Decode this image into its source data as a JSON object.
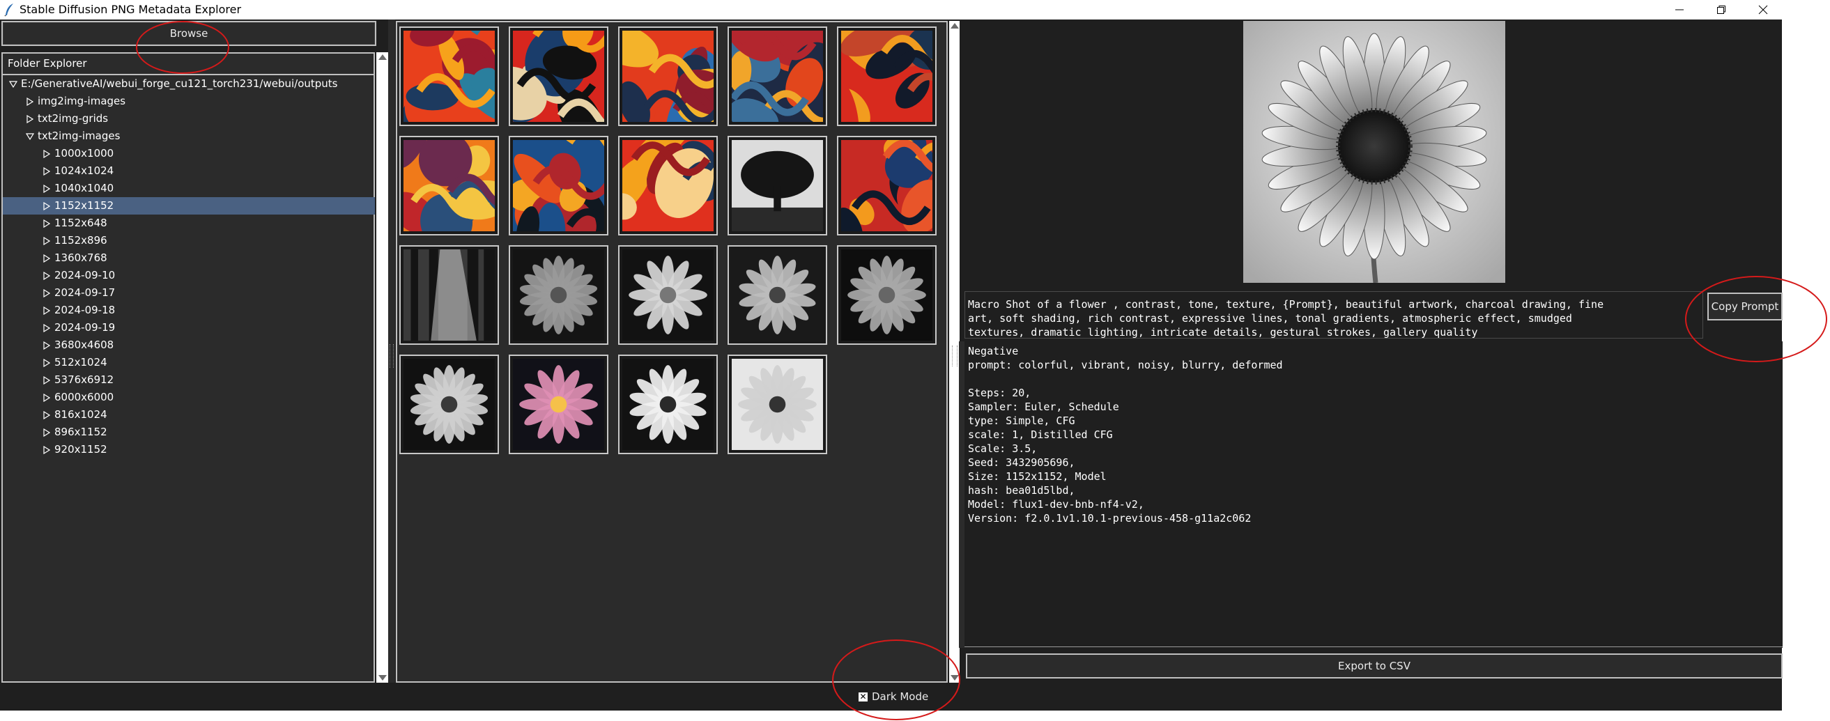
{
  "window": {
    "title": "Stable Diffusion PNG Metadata Explorer"
  },
  "toolbar": {
    "browse_label": "Browse"
  },
  "folder_explorer": {
    "header": "Folder Explorer",
    "items": [
      {
        "label": "E:/GenerativeAI/webui_forge_cu121_torch231/webui/outputs",
        "level": 0,
        "expanded": true,
        "selected": false
      },
      {
        "label": "img2img-images",
        "level": 1,
        "expanded": false,
        "selected": false
      },
      {
        "label": "txt2img-grids",
        "level": 1,
        "expanded": false,
        "selected": false
      },
      {
        "label": "txt2img-images",
        "level": 1,
        "expanded": true,
        "selected": false
      },
      {
        "label": "1000x1000",
        "level": 2,
        "expanded": false,
        "selected": false
      },
      {
        "label": "1024x1024",
        "level": 2,
        "expanded": false,
        "selected": false
      },
      {
        "label": "1040x1040",
        "level": 2,
        "expanded": false,
        "selected": false
      },
      {
        "label": "1152x1152",
        "level": 2,
        "expanded": false,
        "selected": true
      },
      {
        "label": "1152x648",
        "level": 2,
        "expanded": false,
        "selected": false
      },
      {
        "label": "1152x896",
        "level": 2,
        "expanded": false,
        "selected": false
      },
      {
        "label": "1360x768",
        "level": 2,
        "expanded": false,
        "selected": false
      },
      {
        "label": "2024-09-10",
        "level": 2,
        "expanded": false,
        "selected": false
      },
      {
        "label": "2024-09-17",
        "level": 2,
        "expanded": false,
        "selected": false
      },
      {
        "label": "2024-09-18",
        "level": 2,
        "expanded": false,
        "selected": false
      },
      {
        "label": "2024-09-19",
        "level": 2,
        "expanded": false,
        "selected": false
      },
      {
        "label": "3680x4608",
        "level": 2,
        "expanded": false,
        "selected": false
      },
      {
        "label": "512x1024",
        "level": 2,
        "expanded": false,
        "selected": false
      },
      {
        "label": "5376x6912",
        "level": 2,
        "expanded": false,
        "selected": false
      },
      {
        "label": "6000x6000",
        "level": 2,
        "expanded": false,
        "selected": false
      },
      {
        "label": "816x1024",
        "level": 2,
        "expanded": false,
        "selected": false
      },
      {
        "label": "896x1152",
        "level": 2,
        "expanded": false,
        "selected": false
      },
      {
        "label": "920x1152",
        "level": 2,
        "expanded": false,
        "selected": false
      }
    ]
  },
  "gallery": {
    "thumbnails": [
      {
        "kind": "abstract",
        "palette": [
          "#e8401c",
          "#1d3a5f",
          "#f7a21b",
          "#9c1b2e",
          "#2a7f9e"
        ]
      },
      {
        "kind": "abstract",
        "palette": [
          "#d7261e",
          "#1a3d6b",
          "#f59b17",
          "#111111",
          "#e8d2a6"
        ]
      },
      {
        "kind": "abstract",
        "palette": [
          "#e23b1d",
          "#2b6cb0",
          "#f4b32a",
          "#8f1d2c",
          "#1d2f4d"
        ]
      },
      {
        "kind": "abstract",
        "palette": [
          "#1e2a44",
          "#e2461c",
          "#f1a52a",
          "#b3262e",
          "#3b6f9a"
        ]
      },
      {
        "kind": "abstract",
        "palette": [
          "#d82a1e",
          "#1b3350",
          "#f29c1f",
          "#121a2a",
          "#c4452a"
        ]
      },
      {
        "kind": "abstract",
        "palette": [
          "#f07a1a",
          "#c0262a",
          "#2a4f7a",
          "#f4c542",
          "#6b2a4e"
        ]
      },
      {
        "kind": "abstract",
        "palette": [
          "#1b4f8a",
          "#e8501e",
          "#f4a623",
          "#101820",
          "#b0262c"
        ]
      },
      {
        "kind": "abstract",
        "palette": [
          "#e0301e",
          "#f4a21c",
          "#1d3557",
          "#9b1d20",
          "#f7d08a"
        ]
      },
      {
        "kind": "tree",
        "palette": [
          "#ffffff",
          "#000000"
        ]
      },
      {
        "kind": "abstract",
        "palette": [
          "#c72a24",
          "#1c3b6e",
          "#f39a1d",
          "#0f1a2b",
          "#e8552a"
        ]
      },
      {
        "kind": "forest",
        "palette": [
          "#d9d9d9",
          "#1a1a1a"
        ]
      },
      {
        "kind": "flower",
        "palette": [
          "#9a9a9a",
          "#141414",
          "#555555"
        ]
      },
      {
        "kind": "flower",
        "palette": [
          "#d6d6d6",
          "#121212",
          "#777777"
        ]
      },
      {
        "kind": "flower",
        "palette": [
          "#bdbdbd",
          "#1a1a1a",
          "#444444"
        ]
      },
      {
        "kind": "flower",
        "palette": [
          "#a8a8a8",
          "#0e0e0e",
          "#666666"
        ]
      },
      {
        "kind": "flower",
        "palette": [
          "#cfcfcf",
          "#111111",
          "#3a3a3a"
        ]
      },
      {
        "kind": "flower",
        "palette": [
          "#e08fb4",
          "#111118",
          "#f5c14a"
        ]
      },
      {
        "kind": "flower",
        "palette": [
          "#f0f0f0",
          "#121212",
          "#2a2a2a"
        ]
      },
      {
        "kind": "flower",
        "palette": [
          "#d0d0d0",
          "#e6e6e6",
          "#333333"
        ]
      }
    ]
  },
  "details": {
    "prompt": "Macro Shot of a flower , contrast, tone, texture, {Prompt}, beautiful artwork, charcoal drawing, fine\nart, soft shading, rich contrast, expressive lines, tonal gradients, atmospheric effect, smudged\ntextures, dramatic lighting, intricate details, gestural strokes, gallery quality",
    "copy_prompt_label": "Copy Prompt",
    "metadata": "Negative\nprompt: colorful, vibrant, noisy, blurry, deformed\n\nSteps: 20,\nSampler: Euler, Schedule\ntype: Simple, CFG\nscale: 1, Distilled CFG\nScale: 3.5,\nSeed: 3432905696,\nSize: 1152x1152, Model\nhash: bea01d5lbd,\nModel: flux1-dev-bnb-nf4-v2,\nVersion: f2.0.1v1.10.1-previous-458-g11a2c062",
    "export_label": "Export to CSV"
  },
  "footer": {
    "dark_mode_label": "Dark Mode",
    "dark_mode_checked": true
  },
  "colors": {
    "background": "#1f1f1f",
    "panel": "#2b2b2b",
    "selection": "#4a6182",
    "annotation": "#d51a1a"
  }
}
